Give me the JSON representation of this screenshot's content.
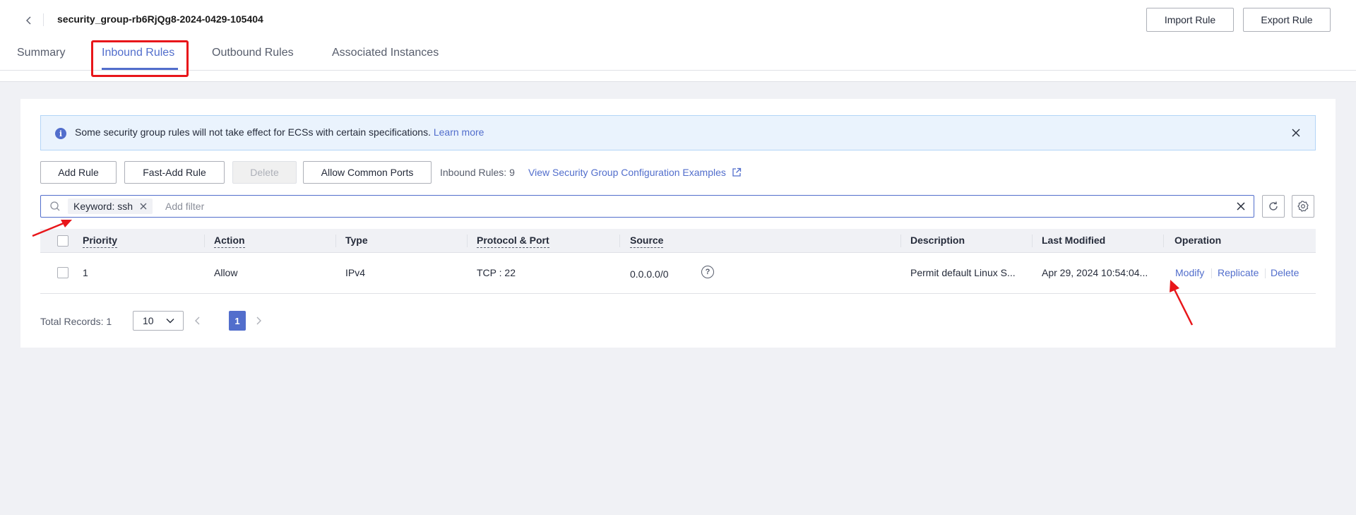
{
  "header": {
    "title": "security_group-rb6RjQg8-2024-0429-105404",
    "import_label": "Import Rule",
    "export_label": "Export Rule"
  },
  "tabs": [
    {
      "label": "Summary",
      "active": false
    },
    {
      "label": "Inbound Rules",
      "active": true
    },
    {
      "label": "Outbound Rules",
      "active": false
    },
    {
      "label": "Associated Instances",
      "active": false
    }
  ],
  "alert": {
    "text": "Some security group rules will not take effect for ECSs with certain specifications.",
    "link": "Learn more"
  },
  "toolbar": {
    "add_rule": "Add Rule",
    "fast_add_rule": "Fast-Add Rule",
    "delete": "Delete",
    "allow_common_ports": "Allow Common Ports",
    "rule_count": "Inbound Rules: 9",
    "config_link": "View Security Group Configuration Examples"
  },
  "search": {
    "tag": "Keyword: ssh",
    "placeholder": "Add filter"
  },
  "table": {
    "columns": [
      "Priority",
      "Action",
      "Type",
      "Protocol & Port",
      "Source",
      "Description",
      "Last Modified",
      "Operation"
    ],
    "rows": [
      {
        "priority": "1",
        "action": "Allow",
        "type": "IPv4",
        "protocol_port": "TCP : 22",
        "source": "0.0.0.0/0",
        "description": "Permit default Linux S...",
        "last_modified": "Apr 29, 2024 10:54:04...",
        "ops": [
          "Modify",
          "Replicate",
          "Delete"
        ]
      }
    ]
  },
  "pagination": {
    "total": "Total Records: 1",
    "page_size": "10",
    "current_page": "1"
  },
  "colors": {
    "accent": "#526ecc",
    "highlight": "#e8161a",
    "alert_bg": "#eaf3fd"
  }
}
